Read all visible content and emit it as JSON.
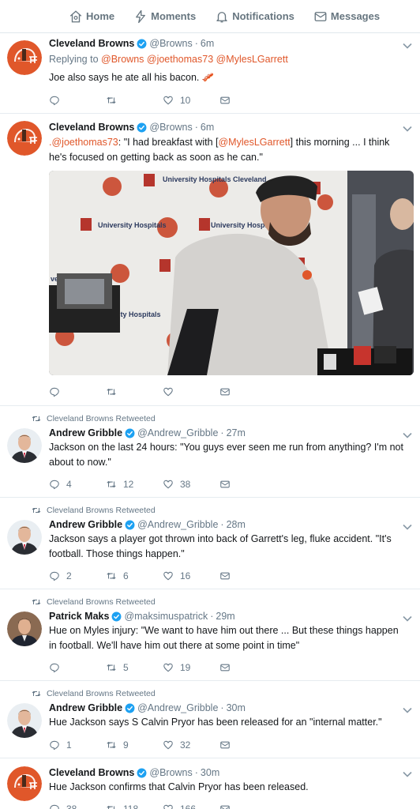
{
  "nav": {
    "home": "Home",
    "moments": "Moments",
    "notifications": "Notifications",
    "messages": "Messages"
  },
  "tweets": [
    {
      "name": "Cleveland Browns",
      "handle": "@Browns",
      "time": "6m",
      "reply_prefix": "Replying to",
      "reply_users": "@Browns @joethomas73 @MylesLGarrett",
      "text": "Joe also says he ate all his bacon. 🥓",
      "replies": "",
      "retweets": "",
      "likes": "10"
    },
    {
      "name": "Cleveland Browns",
      "handle": "@Browns",
      "time": "6m",
      "text_parts": [
        ".@joethomas73",
        ": \"I had breakfast with [",
        "@MylesLGarrett",
        "] this morning ... I think he's focused on getting back as soon as he can.\""
      ],
      "replies": "",
      "retweets": "",
      "likes": "",
      "media_texts": [
        "University Hospitals Cleveland",
        "University Hospitals",
        "versity"
      ]
    },
    {
      "retweeted_by": "Cleveland Browns Retweeted",
      "name": "Andrew Gribble",
      "handle": "@Andrew_Gribble",
      "time": "27m",
      "text": "Jackson on the last 24 hours: \"You guys ever seen me run from anything? I'm not about to now.\"",
      "replies": "4",
      "retweets": "12",
      "likes": "38"
    },
    {
      "retweeted_by": "Cleveland Browns Retweeted",
      "name": "Andrew Gribble",
      "handle": "@Andrew_Gribble",
      "time": "28m",
      "text": "Jackson says a player got thrown into back of Garrett's leg, fluke accident. \"It's football. Those things happen.\"",
      "replies": "2",
      "retweets": "6",
      "likes": "16"
    },
    {
      "retweeted_by": "Cleveland Browns Retweeted",
      "name": "Patrick Maks",
      "handle": "@maksimuspatrick",
      "time": "29m",
      "text": "Hue on Myles injury: \"We want to have him out there ... But these things happen in football. We'll have him out there at some point in time\"",
      "replies": "",
      "retweets": "5",
      "likes": "19"
    },
    {
      "retweeted_by": "Cleveland Browns Retweeted",
      "name": "Andrew Gribble",
      "handle": "@Andrew_Gribble",
      "time": "30m",
      "text": "Hue Jackson says S Calvin Pryor has been released for an \"internal matter.\"",
      "replies": "1",
      "retweets": "9",
      "likes": "32"
    },
    {
      "name": "Cleveland Browns",
      "handle": "@Browns",
      "time": "30m",
      "text": "Hue Jackson confirms that Calvin Pryor has been released.",
      "replies": "38",
      "retweets": "118",
      "likes": "166"
    }
  ],
  "colors": {
    "link": "#e0572a",
    "verified": "#1da1f2",
    "muted": "#657786",
    "browns_orange": "#e0572a"
  }
}
